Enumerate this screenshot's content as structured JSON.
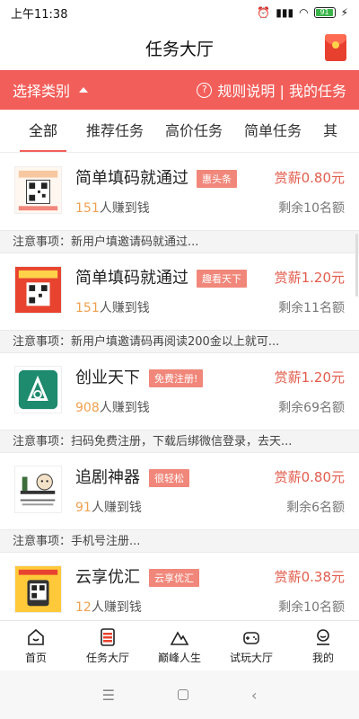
{
  "status_bar": {
    "time": "上午11:38",
    "battery": "91"
  },
  "header": {
    "title": "任务大厅",
    "right_icon": "red-packet-icon"
  },
  "filter": {
    "category_label": "选择类别",
    "rules_label": "规则说明 | 我的任务"
  },
  "tabs": [
    {
      "label": "全部"
    },
    {
      "label": "推荐任务"
    },
    {
      "label": "高价任务"
    },
    {
      "label": "简单任务"
    },
    {
      "label": "其"
    }
  ],
  "tasks": [
    {
      "name": "简单填码就通过",
      "tag": "惠头条",
      "earned_count": "151",
      "earned_suffix": "人赚到钱",
      "reward": "赏薪0.80元",
      "remaining": "剩余10名额",
      "note": "注意事项：新用户填邀请码就通过..."
    },
    {
      "name": "简单填码就通过",
      "tag": "趣看天下",
      "earned_count": "151",
      "earned_suffix": "人赚到钱",
      "reward": "赏薪1.20元",
      "remaining": "剩余11名额",
      "note": "注意事项：新用户填邀请码再阅读200金以上就可..."
    },
    {
      "name": "创业天下",
      "tag": "免费注册!",
      "earned_count": "908",
      "earned_suffix": "人赚到钱",
      "reward": "赏薪1.20元",
      "remaining": "剩余69名额",
      "note": "注意事项：扫码免费注册，下载后绑微信登录，去天..."
    },
    {
      "name": "追剧神器",
      "tag": "很轻松",
      "earned_count": "91",
      "earned_suffix": "人赚到钱",
      "reward": "赏薪0.80元",
      "remaining": "剩余6名额",
      "note": "注意事项：手机号注册..."
    },
    {
      "name": "云享优汇",
      "tag": "云享优汇",
      "earned_count": "12",
      "earned_suffix": "人赚到钱",
      "reward": "赏薪0.38元",
      "remaining": "剩余10名额"
    }
  ],
  "bottom_nav": [
    {
      "label": "首页",
      "icon": "home-icon"
    },
    {
      "label": "任务大厅",
      "icon": "task-hall-icon"
    },
    {
      "label": "巅峰人生",
      "icon": "peak-icon"
    },
    {
      "label": "试玩大厅",
      "icon": "gamepad-icon"
    },
    {
      "label": "我的",
      "icon": "profile-icon"
    }
  ],
  "colors": {
    "accent": "#f25f5b",
    "reward": "#e25c4c",
    "tag": "#f0877a",
    "count": "#f0a050"
  }
}
